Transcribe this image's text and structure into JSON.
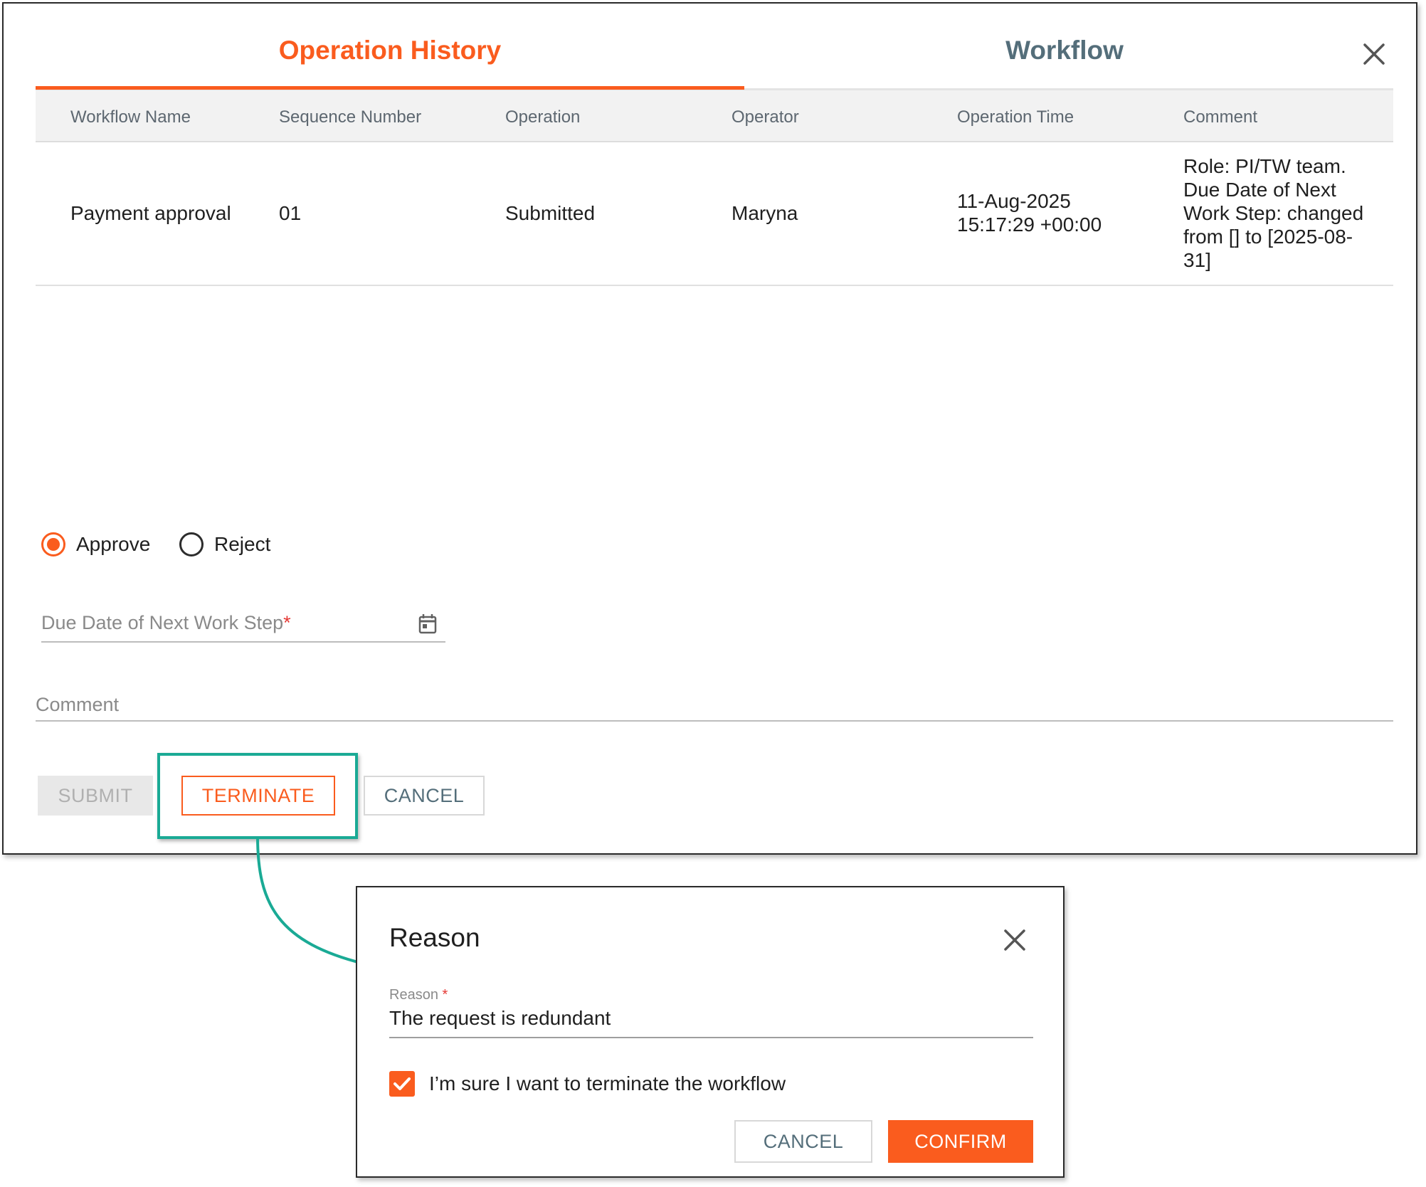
{
  "tabs": [
    {
      "label": "Operation History",
      "active": true
    },
    {
      "label": "Workflow",
      "active": false
    }
  ],
  "table": {
    "headers": [
      "Workflow Name",
      "Sequence Number",
      "Operation",
      "Operator",
      "Operation Time",
      "Comment"
    ],
    "rows": [
      {
        "workflow_name": "Payment approval",
        "sequence_number": "01",
        "operation": "Submitted",
        "operator": "Maryna",
        "operation_time_line1": "11-Aug-2025",
        "operation_time_line2": "15:17:29 +00:00",
        "comment_lines": [
          "Role: PI/TW team.",
          "Due Date of Next",
          "Work Step: changed",
          "from [] to [2025-08-",
          "31]"
        ]
      }
    ]
  },
  "decision": {
    "options": [
      {
        "label": "Approve",
        "selected": true
      },
      {
        "label": "Reject",
        "selected": false
      }
    ]
  },
  "form": {
    "due_date_label": "Due Date of Next Work Step",
    "required_mark": "*",
    "comment_label": "Comment"
  },
  "actions": {
    "submit": "SUBMIT",
    "terminate": "TERMINATE",
    "cancel": "CANCEL"
  },
  "dialog": {
    "title": "Reason",
    "reason_label": "Reason",
    "required_mark": "*",
    "reason_value": "The request is redundant",
    "confirm_checkbox_label": "I’m sure I want to terminate the workflow",
    "confirm_checked": true,
    "cancel": "CANCEL",
    "confirm": "CONFIRM"
  },
  "colors": {
    "accent": "#fa5c1e",
    "tab_inactive": "#546e7a",
    "highlight": "#1aaa95"
  },
  "icons": {
    "close": "close-icon",
    "calendar": "calendar-icon",
    "check": "check-icon",
    "arrow": "connector-arrow"
  }
}
